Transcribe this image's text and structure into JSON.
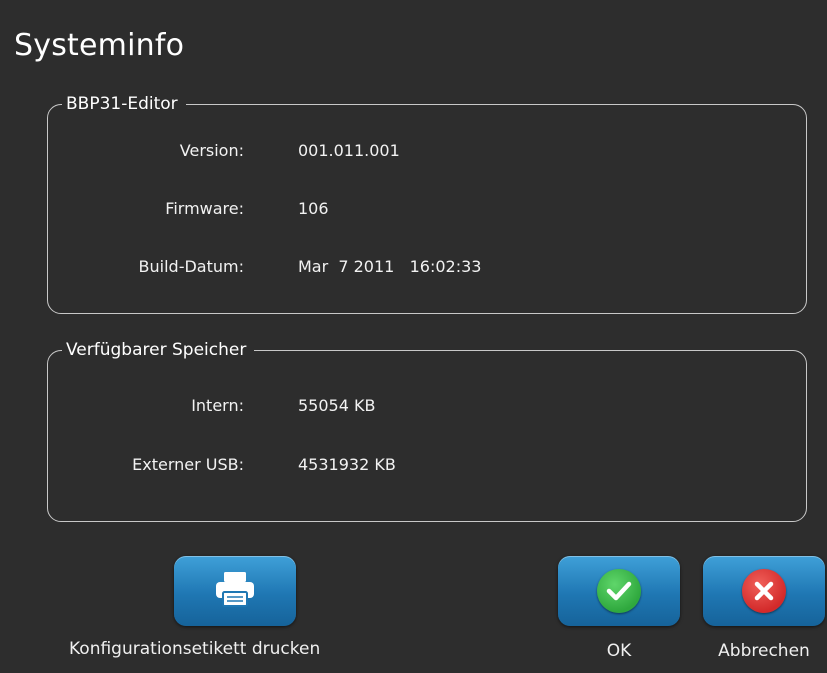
{
  "window": {
    "title": "Systeminfo"
  },
  "editor_group": {
    "legend": "BBP31-Editor",
    "rows": [
      {
        "label": "Version:",
        "value": "001.011.001"
      },
      {
        "label": "Firmware:",
        "value": "106"
      },
      {
        "label": "Build-Datum:",
        "value": "Mar  7 2011   16:02:33"
      }
    ]
  },
  "memory_group": {
    "legend": "Verfügbarer Speicher",
    "rows": [
      {
        "label": "Intern:",
        "value": "55054 KB"
      },
      {
        "label": "Externer USB:",
        "value": "4531932 KB"
      }
    ]
  },
  "buttons": {
    "print_label": "Konfigurationsetikett drucken",
    "print_icon": "printer-icon",
    "ok_label": "OK",
    "ok_icon": "checkmark-icon",
    "cancel_label": "Abbrechen",
    "cancel_icon": "close-icon"
  },
  "colors": {
    "background": "#2d2d2d",
    "button_blue": "#1f77b3",
    "ok_green": "#35b54a",
    "cancel_red": "#e03030"
  }
}
